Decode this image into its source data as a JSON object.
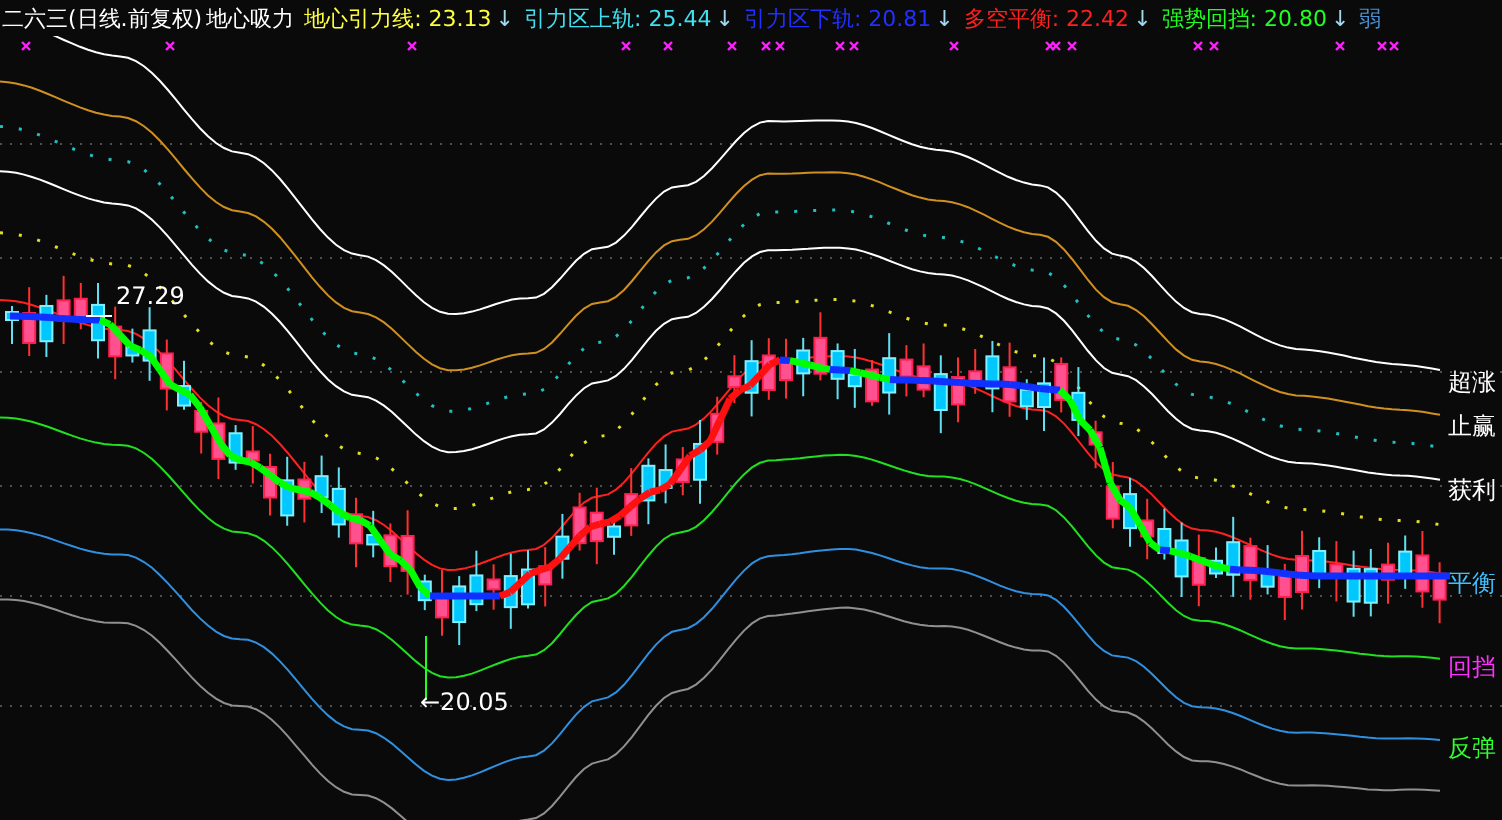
{
  "header": {
    "title": "二六三(日线.前复权)",
    "indicator": "地心吸力",
    "values": [
      {
        "text": "地心引力线: 23.13",
        "arrow": "↓",
        "color": "#ffff40"
      },
      {
        "text": "引力区上轨: 25.44",
        "arrow": "↓",
        "color": "#40e0f0"
      },
      {
        "text": "引力区下轨: 20.81",
        "arrow": "↓",
        "color": "#2030ff"
      },
      {
        "text": "多空平衡: 22.42",
        "arrow": "↓",
        "color": "#ff2020"
      },
      {
        "text": "强势回挡: 20.80",
        "arrow": "↓",
        "color": "#20ff20"
      },
      {
        "text": "弱",
        "color": "#4a90d0"
      }
    ]
  },
  "chart": {
    "price_marks": [
      {
        "text": "27.29",
        "kind": "high"
      },
      {
        "text": "←20.05",
        "kind": "low"
      }
    ],
    "band_labels": [
      {
        "text": "超涨",
        "color": "#ffffff"
      },
      {
        "text": "止赢",
        "color": "#ffffff"
      },
      {
        "text": "获利",
        "color": "#ffffff"
      },
      {
        "text": "平衡",
        "color": "#40c0ff"
      },
      {
        "text": "回挡",
        "color": "#ff30ff"
      },
      {
        "text": "反弹",
        "color": "#30ff30"
      }
    ]
  }
}
